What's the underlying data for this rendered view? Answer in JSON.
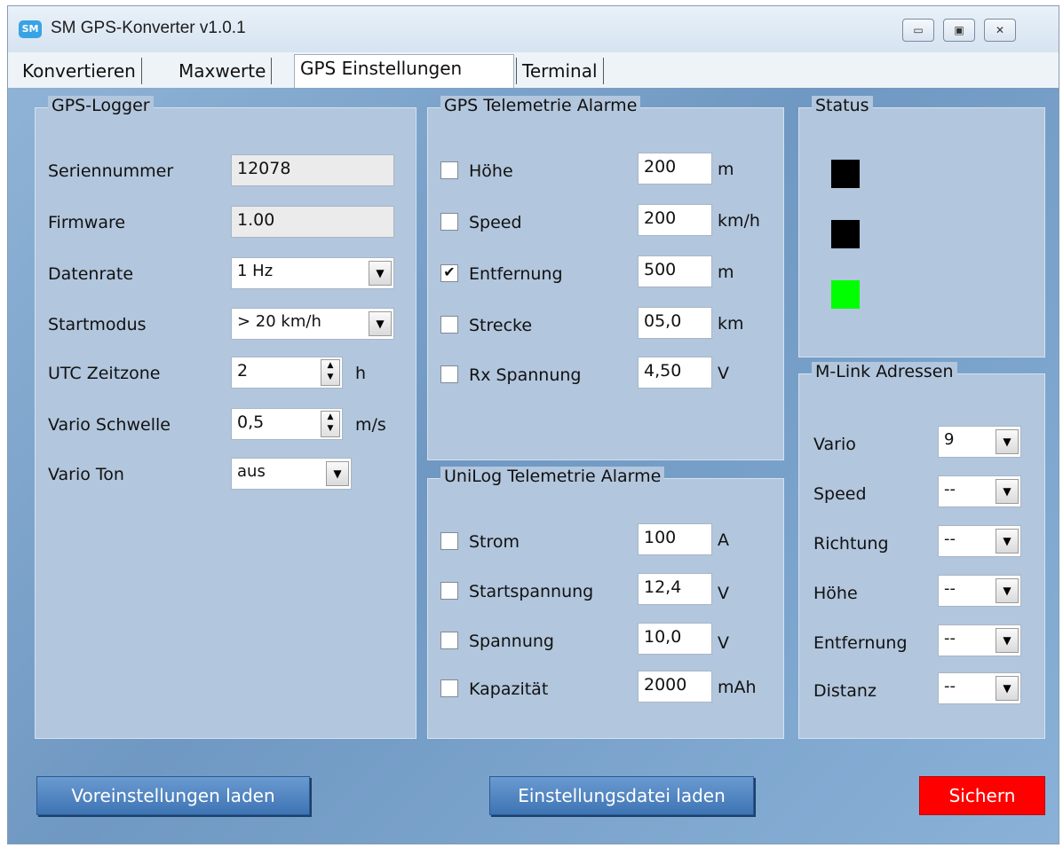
{
  "window": {
    "title": "SM GPS-Konverter v1.0.1",
    "icon_text": "SM"
  },
  "tabs": [
    {
      "label": "Konvertieren"
    },
    {
      "label": "Maxwerte"
    },
    {
      "label": "GPS Einstellungen"
    },
    {
      "label": "Terminal"
    }
  ],
  "logger": {
    "title": "GPS-Logger",
    "serial_label": "Seriennummer",
    "serial_value": "12078",
    "firmware_label": "Firmware",
    "firmware_value": "1.00",
    "datenrate_label": "Datenrate",
    "datenrate_value": "1 Hz",
    "startmodus_label": "Startmodus",
    "startmodus_value": "> 20 km/h",
    "utc_label": "UTC Zeitzone",
    "utc_value": "2",
    "utc_unit": "h",
    "vario_label": "Vario Schwelle",
    "vario_value": "0,5",
    "vario_unit": "m/s",
    "ton_label": "Vario Ton",
    "ton_value": "aus"
  },
  "gps_alarms": {
    "title": "GPS Telemetrie Alarme",
    "rows": [
      {
        "label": "Höhe",
        "value": "200",
        "unit": "m",
        "checked": ""
      },
      {
        "label": "Speed",
        "value": "200",
        "unit": "km/h",
        "checked": ""
      },
      {
        "label": "Entfernung",
        "value": "500",
        "unit": "m",
        "checked": "✔"
      },
      {
        "label": "Strecke",
        "value": "05,0",
        "unit": "km",
        "checked": ""
      },
      {
        "label": "Rx Spannung",
        "value": "4,50",
        "unit": "V",
        "checked": ""
      }
    ]
  },
  "unilog_alarms": {
    "title": "UniLog Telemetrie Alarme",
    "rows": [
      {
        "label": "Strom",
        "value": "100",
        "unit": "A",
        "checked": ""
      },
      {
        "label": "Startspannung",
        "value": "12,4",
        "unit": "V",
        "checked": ""
      },
      {
        "label": "Spannung",
        "value": "10,0",
        "unit": "V",
        "checked": ""
      },
      {
        "label": "Kapazität",
        "value": "2000",
        "unit": "mAh",
        "checked": ""
      }
    ]
  },
  "status": {
    "title": "Status",
    "colors": [
      "#000000",
      "#000000",
      "#00ff00"
    ]
  },
  "mlink": {
    "title": "M-Link Adressen",
    "rows": [
      {
        "label": "Vario",
        "value": "9"
      },
      {
        "label": "Speed",
        "value": "--"
      },
      {
        "label": "Richtung",
        "value": "--"
      },
      {
        "label": "Höhe",
        "value": "--"
      },
      {
        "label": "Entfernung",
        "value": "--"
      },
      {
        "label": "Distanz",
        "value": "--"
      }
    ]
  },
  "buttons": {
    "preset": "Voreinstellungen laden",
    "file": "Einstellungsdatei laden",
    "save": "Sichern"
  }
}
